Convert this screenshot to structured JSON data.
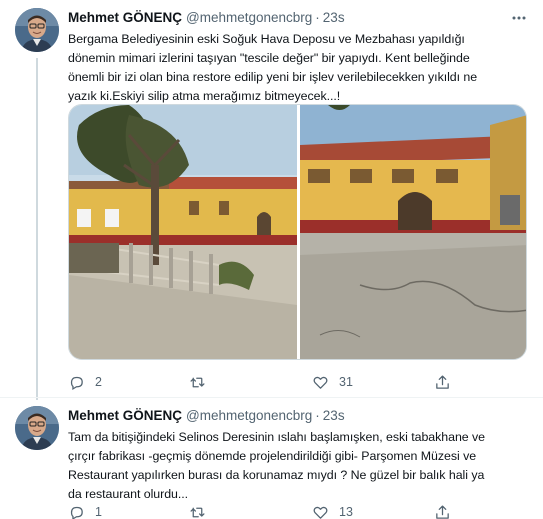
{
  "tweets": [
    {
      "display_name": "Mehmet GÖNENÇ",
      "handle": "@mehmetgonencbrg",
      "separator": "·",
      "time": "23s",
      "text": "Bergama Belediyesinin eski Soğuk Hava Deposu ve Mezbahası yapıldığı\ndönemin mimari izlerini taşıyan \"tescile değer\" bir yapıydı. Kent belleğinde\nönemli bir izi olan bina restore edilip yeni bir işlev verilebilecekken yıkıldı ne\nyazık ki.Eskiyi silip atma merağımız bitmeyecek...!",
      "images": [
        "building-with-tree-and-fence",
        "building-front-courtyard"
      ],
      "actions": {
        "replies": "2",
        "retweets": "",
        "likes": "31"
      }
    },
    {
      "display_name": "Mehmet GÖNENÇ",
      "handle": "@mehmetgonencbrg",
      "separator": "·",
      "time": "23s",
      "text": "Tam da  bitişiğindeki Selinos Deresinin ıslahı başlamışken, eski tabakhane ve\nçırçır fabrikası -geçmiş dönemde projelendirildiği gibi- Parşomen Müzesi ve\nRestaurant yapılırken burası da korunamaz mıydı ? Ne güzel bir balık hali ya\nda restaurant olurdu...",
      "images": [],
      "actions": {
        "replies": "1",
        "retweets": "",
        "likes": "13"
      }
    }
  ],
  "icons": {
    "more": "more-dots-icon",
    "reply": "reply-icon",
    "retweet": "retweet-icon",
    "like": "like-icon",
    "share": "share-icon"
  },
  "colors": {
    "text": "#0f1419",
    "secondary": "#536471",
    "border": "#cfd9de"
  }
}
